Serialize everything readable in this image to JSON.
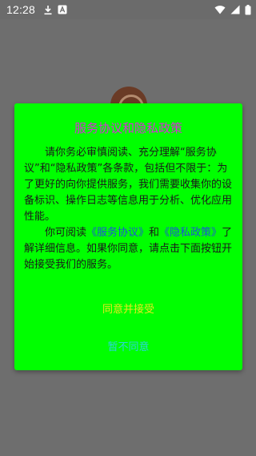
{
  "status_bar": {
    "time": "12:28",
    "left_icons": [
      "download-icon",
      "notification-a-icon"
    ],
    "right_icons": [
      "wifi-icon",
      "signal-icon",
      "battery-icon"
    ]
  },
  "dialog": {
    "title": "服务协议和隐私政策",
    "paragraph1": "请你务必审慎阅读、充分理解“服务协议”和“隐私政策”各条款，包括但不限于：为了更好的向你提供服务，我们需要收集你的设备标识、操作日志等信息用于分析、优化应用性能。",
    "paragraph2_before": "你可阅读",
    "link_service": "《服务协议》",
    "paragraph2_and": "和",
    "link_privacy": "《隐私政策》",
    "paragraph2_after": "了解详细信息。如果你同意，请点击下面按钮开始接受我们的服务。",
    "agree_label": "同意并接受",
    "disagree_label": "暂不同意"
  },
  "colors": {
    "dialog_bg": "#00ff00",
    "title": "#d82fd8",
    "link": "#1a55d6",
    "agree": "#e8e820",
    "disagree": "#2bd3e0",
    "scrim": "#6e6e6e"
  }
}
